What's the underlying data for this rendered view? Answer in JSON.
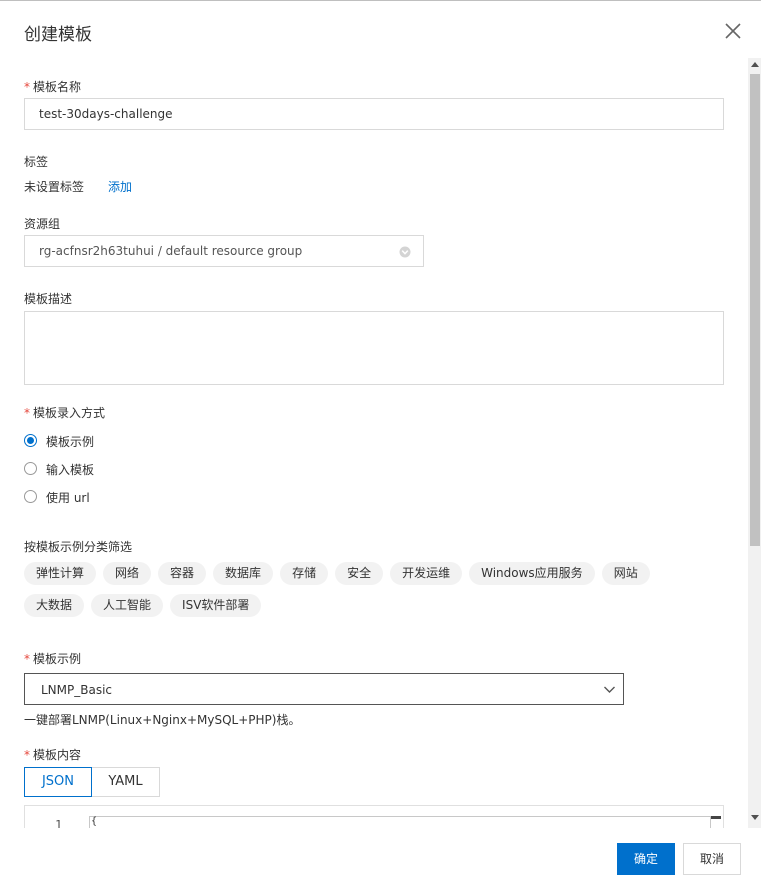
{
  "dialog": {
    "title": "创建模板"
  },
  "form": {
    "template_name": {
      "label": "模板名称",
      "value": "test-30days-challenge",
      "required": "*"
    },
    "tags": {
      "label": "标签",
      "status": "未设置标签",
      "add_link": "添加"
    },
    "resource_group": {
      "label": "资源组",
      "value": "rg-acfnsr2h63tuhui / default resource group"
    },
    "description": {
      "label": "模板描述",
      "value": ""
    },
    "input_method": {
      "label": "模板录入方式",
      "options": [
        "模板示例",
        "输入模板",
        "使用 url"
      ],
      "selected": "模板示例"
    },
    "category_filter": {
      "label": "按模板示例分类筛选",
      "chips": [
        "弹性计算",
        "网络",
        "容器",
        "数据库",
        "存储",
        "安全",
        "开发运维",
        "Windows应用服务",
        "网站",
        "大数据",
        "人工智能",
        "ISV软件部署"
      ]
    },
    "example": {
      "label": "模板示例",
      "value": "LNMP_Basic",
      "hint": "一键部署LNMP(Linux+Nginx+MySQL+PHP)栈。"
    },
    "content": {
      "label": "模板内容",
      "tabs": [
        "JSON",
        "YAML"
      ],
      "active_tab": "JSON",
      "line_number": "1",
      "first_line": "{"
    }
  },
  "footer": {
    "confirm_label": "确定",
    "cancel_label": "取消"
  },
  "colors": {
    "primary": "#0070cc",
    "required": "#e5473c",
    "chip_bg": "#f2f2f2"
  },
  "icons": [
    "close-icon",
    "chevron-down-icon",
    "select-arrow-icon"
  ]
}
